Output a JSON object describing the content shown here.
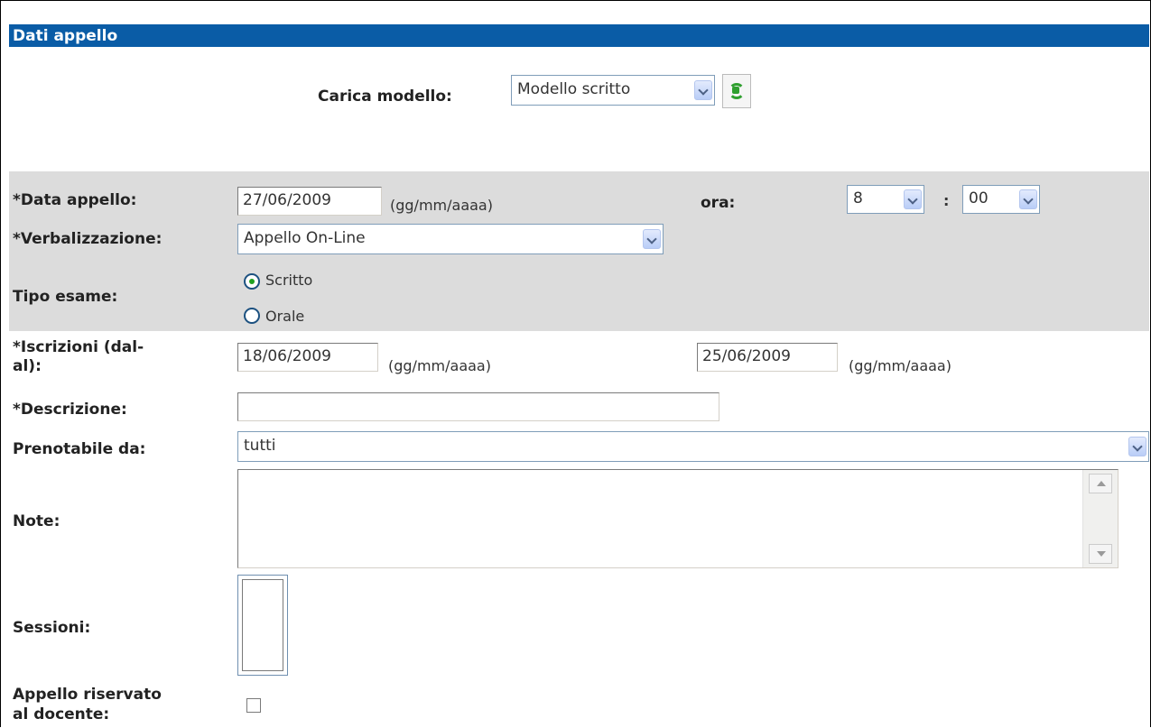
{
  "panel": {
    "title": "Dati appello"
  },
  "modello": {
    "label": "Carica modello:",
    "value": "Modello scritto"
  },
  "data_appello": {
    "label": "*Data appello:",
    "value": "27/06/2009",
    "hint": "(gg/mm/aaaa)"
  },
  "ora": {
    "label": "ora:",
    "hour": "8",
    "separator": ":",
    "minute": "00"
  },
  "verbalizzazione": {
    "label": "*Verbalizzazione:",
    "value": "Appello On-Line"
  },
  "tipo_esame": {
    "label": "Tipo esame:",
    "options": [
      {
        "label": "Scritto",
        "selected": true
      },
      {
        "label": "Orale",
        "selected": false
      }
    ]
  },
  "iscrizioni": {
    "label_line1": "*Iscrizioni (dal-",
    "label_line2": "al):",
    "from": "18/06/2009",
    "to": "25/06/2009",
    "hint": "(gg/mm/aaaa)"
  },
  "descrizione": {
    "label": "*Descrizione:",
    "value": ""
  },
  "prenotabile": {
    "label": "Prenotabile da:",
    "value": "tutti"
  },
  "note": {
    "label": "Note:",
    "value": ""
  },
  "sessioni": {
    "label": "Sessioni:"
  },
  "riservato": {
    "label_line1": "Appello riservato",
    "label_line2": "al docente:",
    "checked": false
  },
  "colors": {
    "titlebar": "#0a5ca6",
    "band": "#dcdcdc"
  }
}
